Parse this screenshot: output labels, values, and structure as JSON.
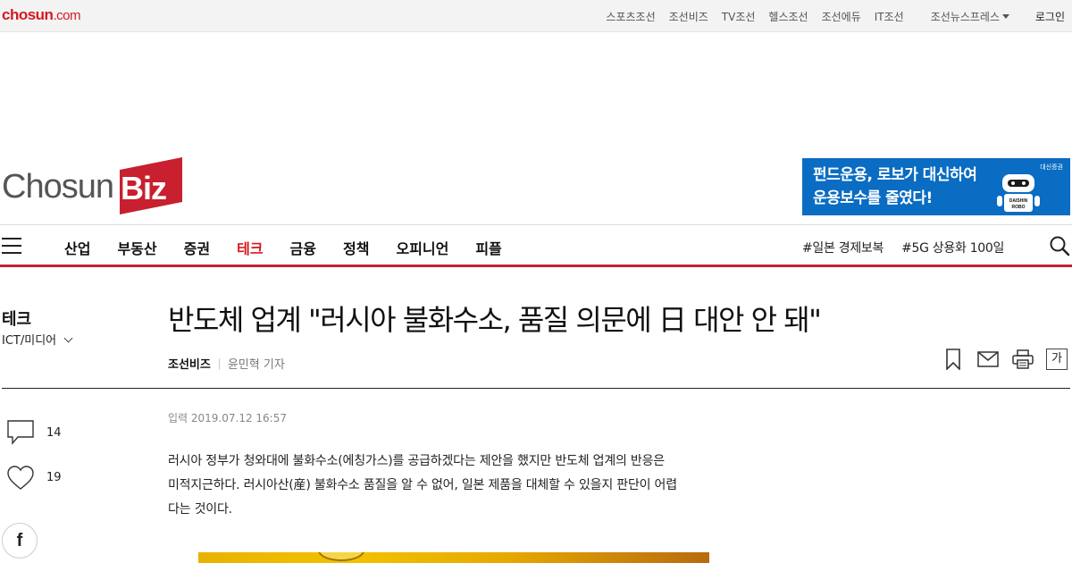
{
  "topbar": {
    "logo_main": "chosun",
    "logo_suffix": ".com",
    "links": [
      "스포츠조선",
      "조선비즈",
      "TV조선",
      "헬스조선",
      "조선에듀",
      "IT조선",
      "조선뉴스프레스"
    ],
    "login": "로그인"
  },
  "header": {
    "logo_left": "Chosun",
    "logo_right": "Biz",
    "ad": {
      "line1": "펀드운용, 로보가 대신하여",
      "line2": "운용보수를 줄였다!",
      "brand": "대신증권",
      "robo_label1": "DAISHIN",
      "robo_label2": "ROBO"
    }
  },
  "nav": {
    "items": [
      "산업",
      "부동산",
      "증권",
      "테크",
      "금융",
      "정책",
      "오피니언",
      "피플"
    ],
    "active_index": 3,
    "tags": [
      "#일본 경제보복",
      "#5G 상용화 100일"
    ]
  },
  "section": {
    "title": "테크",
    "subsection": "ICT/미디어"
  },
  "article": {
    "headline": "반도체 업계 \"러시아 불화수소, 품질 의문에 日 대안 안 돼\"",
    "outlet": "조선비즈",
    "reporter": "윤민혁 기자",
    "font_button": "가",
    "date": "입력 2019.07.12 16:57",
    "body_lines": [
      "러시아 정부가 청와대에 불화수소(에칭가스)를 공급하겠다는 제안을 했지만 반도체 업계의 반응은",
      "미적지근하다. 러시아산(産) 불화수소 품질을 알 수 없어, 일본 제품을 대체할 수 있을지 판단이 어렵",
      "다는 것이다."
    ]
  },
  "social": {
    "comments": "14",
    "likes": "19",
    "facebook": "f"
  },
  "colors": {
    "brand_red": "#d71920",
    "nav_rule": "#c8202e",
    "ad_blue": "#0a6cc2"
  }
}
